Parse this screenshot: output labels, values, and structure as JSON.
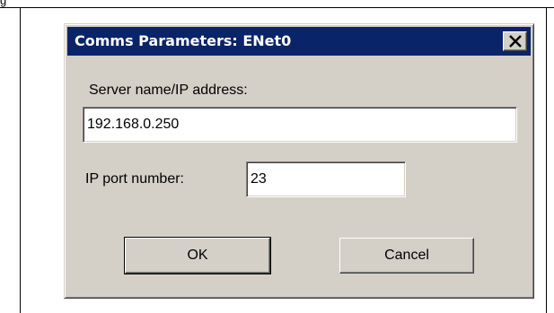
{
  "page": {
    "caption_fragment": "g"
  },
  "dialog": {
    "title": "Comms Parameters: ENet0",
    "close_icon": "close-x-icon",
    "server_label": "Server name/IP address:",
    "server_value": "192.168.0.250",
    "port_label": "IP port number:",
    "port_value": "23",
    "ok_label": "OK",
    "cancel_label": "Cancel"
  },
  "colors": {
    "titlebar": "#0a246a",
    "face": "#d4d0c8"
  }
}
